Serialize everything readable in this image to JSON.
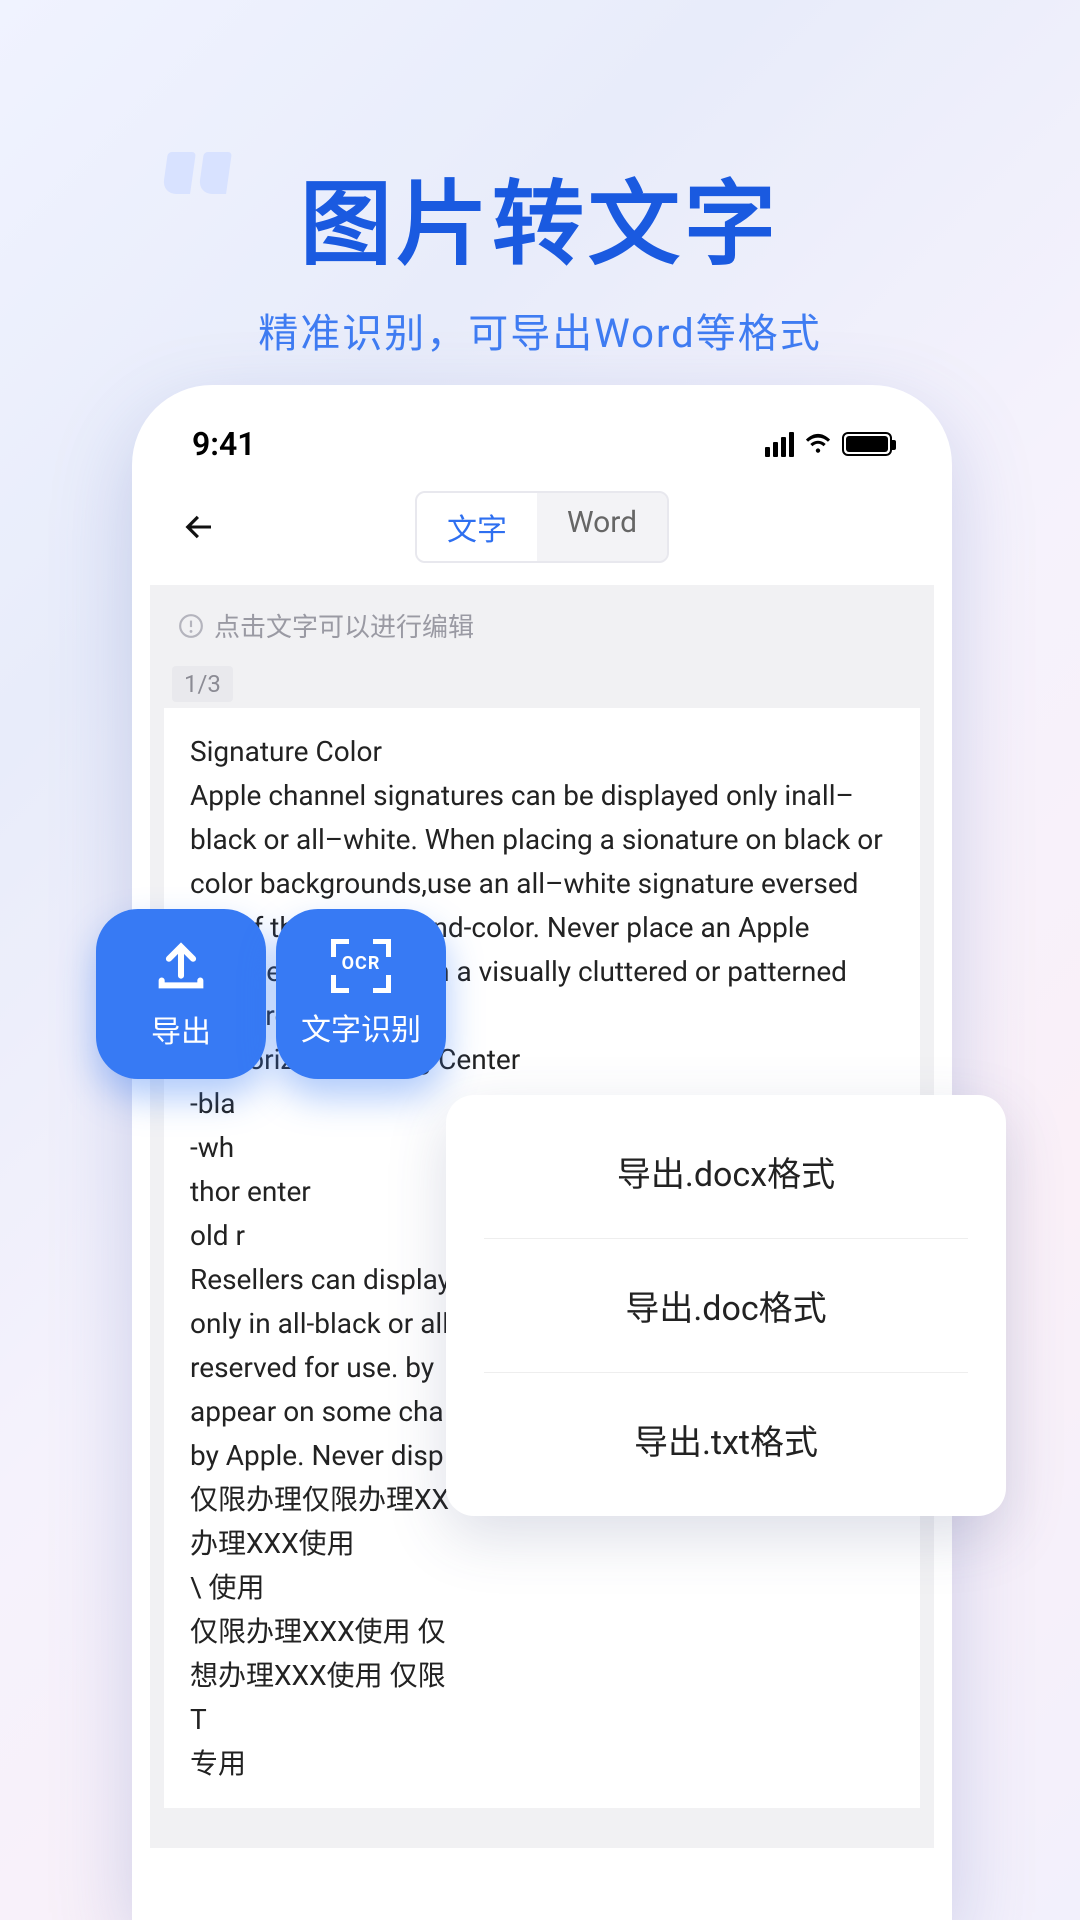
{
  "hero": {
    "title": "图片转文字",
    "subtitle": "精准识别，可导出Word等格式"
  },
  "statusbar": {
    "time": "9:41"
  },
  "segmented": {
    "items": [
      "文字",
      "Word"
    ],
    "active_index": 0
  },
  "hint": "点击文字可以进行编辑",
  "page_indicator": "1/3",
  "doc_text": "Signature Color\nApple channel signatures can be displayed only inall–black or all–white. When placing a sionature on black or color backgrounds,use an all–white signature eversed out of the background-color. Never place an Apple channel signature on a visually cluttered or patterned background.\nAuthorized Training Center\n-bla\n-wh\nthor                          enter\nold r\nResellers can display their Apple-provided authorization only in all-black or all–white. An Apple l\nreserved for use. by\nappear on some cha\nby Apple. Never disp\n仅限办理仅限办理XX\n办理XXX使用\n\\ 使用\n仅限办理XXX使用 仅\n想办理XXX使用 仅限\nT\n专用",
  "float_buttons": {
    "export": "导出",
    "ocr": "文字识别",
    "ocr_badge": "OCR"
  },
  "export_options": [
    "导出.docx格式",
    "导出.doc格式",
    "导出.txt格式"
  ]
}
